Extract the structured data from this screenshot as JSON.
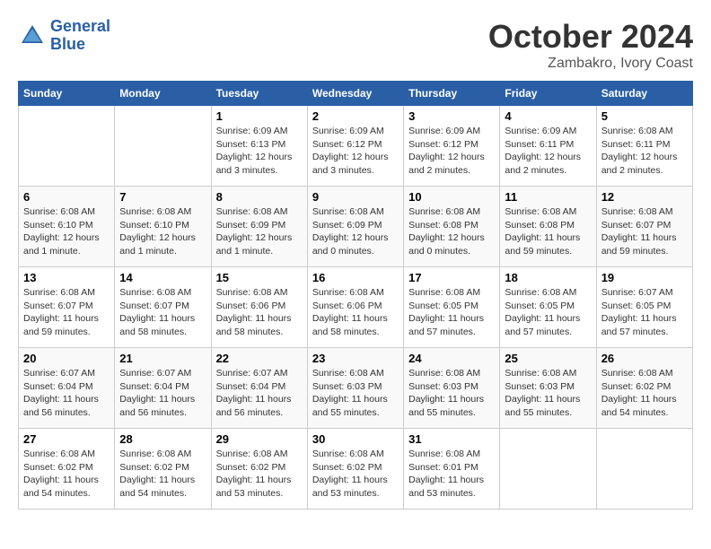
{
  "header": {
    "logo_line1": "General",
    "logo_line2": "Blue",
    "month": "October 2024",
    "location": "Zambakro, Ivory Coast"
  },
  "days_of_week": [
    "Sunday",
    "Monday",
    "Tuesday",
    "Wednesday",
    "Thursday",
    "Friday",
    "Saturday"
  ],
  "weeks": [
    [
      {
        "day": "",
        "info": ""
      },
      {
        "day": "",
        "info": ""
      },
      {
        "day": "1",
        "info": "Sunrise: 6:09 AM\nSunset: 6:13 PM\nDaylight: 12 hours and 3 minutes."
      },
      {
        "day": "2",
        "info": "Sunrise: 6:09 AM\nSunset: 6:12 PM\nDaylight: 12 hours and 3 minutes."
      },
      {
        "day": "3",
        "info": "Sunrise: 6:09 AM\nSunset: 6:12 PM\nDaylight: 12 hours and 2 minutes."
      },
      {
        "day": "4",
        "info": "Sunrise: 6:09 AM\nSunset: 6:11 PM\nDaylight: 12 hours and 2 minutes."
      },
      {
        "day": "5",
        "info": "Sunrise: 6:08 AM\nSunset: 6:11 PM\nDaylight: 12 hours and 2 minutes."
      }
    ],
    [
      {
        "day": "6",
        "info": "Sunrise: 6:08 AM\nSunset: 6:10 PM\nDaylight: 12 hours and 1 minute."
      },
      {
        "day": "7",
        "info": "Sunrise: 6:08 AM\nSunset: 6:10 PM\nDaylight: 12 hours and 1 minute."
      },
      {
        "day": "8",
        "info": "Sunrise: 6:08 AM\nSunset: 6:09 PM\nDaylight: 12 hours and 1 minute."
      },
      {
        "day": "9",
        "info": "Sunrise: 6:08 AM\nSunset: 6:09 PM\nDaylight: 12 hours and 0 minutes."
      },
      {
        "day": "10",
        "info": "Sunrise: 6:08 AM\nSunset: 6:08 PM\nDaylight: 12 hours and 0 minutes."
      },
      {
        "day": "11",
        "info": "Sunrise: 6:08 AM\nSunset: 6:08 PM\nDaylight: 11 hours and 59 minutes."
      },
      {
        "day": "12",
        "info": "Sunrise: 6:08 AM\nSunset: 6:07 PM\nDaylight: 11 hours and 59 minutes."
      }
    ],
    [
      {
        "day": "13",
        "info": "Sunrise: 6:08 AM\nSunset: 6:07 PM\nDaylight: 11 hours and 59 minutes."
      },
      {
        "day": "14",
        "info": "Sunrise: 6:08 AM\nSunset: 6:07 PM\nDaylight: 11 hours and 58 minutes."
      },
      {
        "day": "15",
        "info": "Sunrise: 6:08 AM\nSunset: 6:06 PM\nDaylight: 11 hours and 58 minutes."
      },
      {
        "day": "16",
        "info": "Sunrise: 6:08 AM\nSunset: 6:06 PM\nDaylight: 11 hours and 58 minutes."
      },
      {
        "day": "17",
        "info": "Sunrise: 6:08 AM\nSunset: 6:05 PM\nDaylight: 11 hours and 57 minutes."
      },
      {
        "day": "18",
        "info": "Sunrise: 6:08 AM\nSunset: 6:05 PM\nDaylight: 11 hours and 57 minutes."
      },
      {
        "day": "19",
        "info": "Sunrise: 6:07 AM\nSunset: 6:05 PM\nDaylight: 11 hours and 57 minutes."
      }
    ],
    [
      {
        "day": "20",
        "info": "Sunrise: 6:07 AM\nSunset: 6:04 PM\nDaylight: 11 hours and 56 minutes."
      },
      {
        "day": "21",
        "info": "Sunrise: 6:07 AM\nSunset: 6:04 PM\nDaylight: 11 hours and 56 minutes."
      },
      {
        "day": "22",
        "info": "Sunrise: 6:07 AM\nSunset: 6:04 PM\nDaylight: 11 hours and 56 minutes."
      },
      {
        "day": "23",
        "info": "Sunrise: 6:08 AM\nSunset: 6:03 PM\nDaylight: 11 hours and 55 minutes."
      },
      {
        "day": "24",
        "info": "Sunrise: 6:08 AM\nSunset: 6:03 PM\nDaylight: 11 hours and 55 minutes."
      },
      {
        "day": "25",
        "info": "Sunrise: 6:08 AM\nSunset: 6:03 PM\nDaylight: 11 hours and 55 minutes."
      },
      {
        "day": "26",
        "info": "Sunrise: 6:08 AM\nSunset: 6:02 PM\nDaylight: 11 hours and 54 minutes."
      }
    ],
    [
      {
        "day": "27",
        "info": "Sunrise: 6:08 AM\nSunset: 6:02 PM\nDaylight: 11 hours and 54 minutes."
      },
      {
        "day": "28",
        "info": "Sunrise: 6:08 AM\nSunset: 6:02 PM\nDaylight: 11 hours and 54 minutes."
      },
      {
        "day": "29",
        "info": "Sunrise: 6:08 AM\nSunset: 6:02 PM\nDaylight: 11 hours and 53 minutes."
      },
      {
        "day": "30",
        "info": "Sunrise: 6:08 AM\nSunset: 6:02 PM\nDaylight: 11 hours and 53 minutes."
      },
      {
        "day": "31",
        "info": "Sunrise: 6:08 AM\nSunset: 6:01 PM\nDaylight: 11 hours and 53 minutes."
      },
      {
        "day": "",
        "info": ""
      },
      {
        "day": "",
        "info": ""
      }
    ]
  ]
}
